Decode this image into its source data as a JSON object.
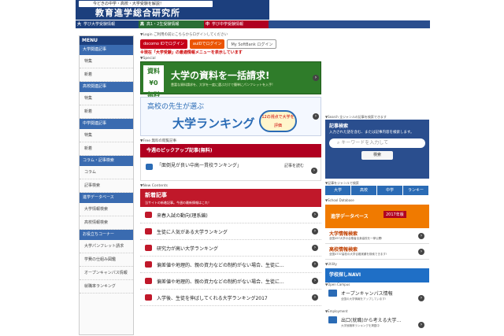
{
  "header": {
    "tagline": "今どきの中学・高校・大学受験を解説！",
    "site_title": "教育進学総合研究所",
    "tabs": [
      {
        "kanji": "大",
        "label": "学び大学受験情報",
        "color": "#1c3f7d"
      },
      {
        "kanji": "高",
        "label": "高1・2生受験情報",
        "color": "#2a6e35"
      },
      {
        "kanji": "中",
        "label": "学び中学受験情報",
        "color": "#b00020"
      }
    ]
  },
  "sidebar": {
    "title": "MENU",
    "sections": [
      {
        "title": "大学関連記事",
        "items": [
          "特集",
          "新着"
        ]
      },
      {
        "title": "高校関連記事",
        "items": [
          "特集",
          "新着"
        ]
      },
      {
        "title": "中学関連記事",
        "items": [
          "特集",
          "新着"
        ]
      },
      {
        "title": "コラム・記事検索",
        "items": [
          "コラム",
          "記事検索"
        ]
      },
      {
        "title": "進学データベース",
        "items": [
          "大学情報検索",
          "高校情報検索"
        ]
      },
      {
        "title": "お役立ちコーナー",
        "items": [
          "大学パンフレット請求",
          "学費の仕組み図鑑",
          "オープンキャンパス情報",
          "就職率ランキング"
        ]
      }
    ]
  },
  "main": {
    "login_bar": "▼Login ご利用の前にこちらからログインしてください",
    "login_buttons": [
      {
        "label": "docomo IDでログイン",
        "color": "#c60018"
      },
      {
        "label": "auIDでログイン",
        "color": "#eb5505"
      },
      {
        "label": "My SoftBank ログイン",
        "color": "#777777"
      }
    ],
    "notice": "※現在「大学受験」の最適情報メニューを表示しています",
    "special_bar": "▼Special",
    "banner1": {
      "yen_top": "資料¥0",
      "yen_bottom": "無料",
      "headline": "大学の資料を一括請求!",
      "sub": "豊富な資料請求を、大学を一度に選ぶだけで簡単にパンフレットを入手!"
    },
    "banner2": {
      "lead": "高校の先生が選ぶ",
      "headline": "大学ランキング",
      "badge": "12の視点で大学を評価"
    },
    "free_bar": "▼Free 無料の閲覧記事",
    "pickup_head": "今週のピックアップ記事(無料)",
    "pickup_item": "「面倒見が良い中高一貫校ランキング」",
    "pickup_link": "記事を読む",
    "new_bar": "▼New Contents",
    "new_title": "新着記事",
    "new_sub": "当サイトの新着記事。今週の最新情報はこれ！",
    "articles": [
      "来春入試の動向(理系編)",
      "生徒に人気がある大学ランキング",
      "研究力が高い大学ランキング",
      "偏差値や地理的、親の資力などの制約がない場合、生徒に...",
      "偏差値や地理的、親の資力などの制約がない場合、生徒に...",
      "入学後、生徒を伸ばしてくれる大学ランキング2017"
    ]
  },
  "right": {
    "search_bar": "▼Search 全ジャンルの記事を検索できます",
    "kw_title": "記事検索",
    "kw_desc": "入力された語を含む、または記事内容を検索します。",
    "kw_placeholder": "キーワードを入力して",
    "kw_button": "検索",
    "genre_bar": "▼記事をジャンルで検索",
    "genres": [
      "大学",
      "高校",
      "中学",
      "ランキー"
    ],
    "db_bar": "▼School Database",
    "db_title": "進学データベース",
    "db_year": "2017年版",
    "db_items": [
      {
        "title": "大学情報検索",
        "desc": "全国497大学の合格者出身高校を一挙公開!"
      },
      {
        "title": "高校情報検索",
        "desc": "全国4737高校の大学合格実績を検索できます!"
      }
    ],
    "utility_bar": "▼Utility",
    "navi": "学校探しNAVI",
    "open_bar": "▼Open Campus",
    "open_title": "オープンキャンパス情報",
    "open_desc": "全国の大学情報をアップしています!",
    "emp_bar": "▼Employment",
    "emp_title": "出口(就職)から考える大学...",
    "emp_desc": "大学就職率ランキングを掲載中"
  }
}
